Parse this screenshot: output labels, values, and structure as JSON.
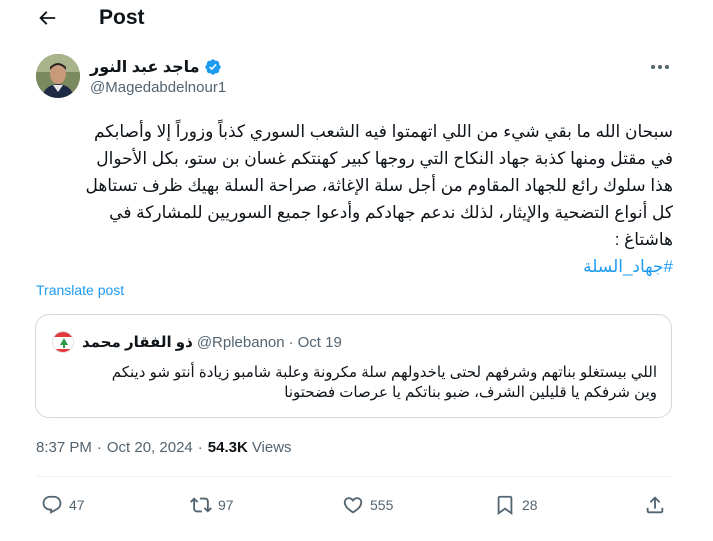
{
  "header": {
    "title": "Post"
  },
  "author": {
    "name": "ماجد عبد النور",
    "handle": "@Magedabdelnour1",
    "verified": true
  },
  "tweet": {
    "lines": [
      "سبحان الله ما بقي شيء من اللي اتهمتوا فيه الشعب السوري كذباً وزوراً إلا وأصابكم",
      "في مقتل ومنها كذبة جهاد النكاح التي روجها كبير كهنتكم غسان بن ستو، بكل الأحوال",
      "هذا سلوك رائع للجهاد المقاوم من أجل سلة الإغاثة، صراحة السلة بهيك ظرف تستاهل",
      "كل أنواع التضحية والإيثار، لذلك ندعم جهادكم وأدعوا جميع السوريين للمشاركة في",
      "هاشتاغ :"
    ],
    "hashtag": "#جهاد_السلة",
    "translate_label": "Translate post"
  },
  "quote": {
    "name": "ذو الفقار محمد",
    "handle": "@Rplebanon",
    "dot": "·",
    "date": "Oct 19",
    "lines": [
      "اللي بيستغلو بناتهم وشرفهم لحتى ياخدولهم سلة مكرونة وعلبة شامبو زيادة أنتو شو دينكم",
      "وين شرفكم يا قليلين الشرف، ضبو بناتكم يا عرصات فضحتونا"
    ]
  },
  "meta": {
    "time": "8:37 PM",
    "sep1": "·",
    "date": "Oct 20, 2024",
    "sep2": "·",
    "views_count": "54.3K",
    "views_label": "Views"
  },
  "actions": {
    "replies": "47",
    "reposts": "97",
    "likes": "555",
    "bookmarks": "28"
  },
  "colors": {
    "accent": "#1d9bf0",
    "text": "#0f1419",
    "secondary": "#536471",
    "border": "#cfd9de"
  },
  "icons": [
    "back-arrow-icon",
    "verified-badge-icon",
    "more-icon",
    "reply-icon",
    "repost-icon",
    "like-icon",
    "bookmark-icon",
    "share-icon"
  ]
}
